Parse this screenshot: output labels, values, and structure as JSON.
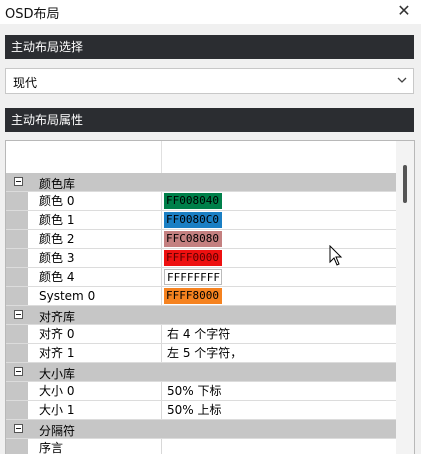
{
  "window": {
    "title": "OSD布局"
  },
  "section1": {
    "title": "主动布局选择"
  },
  "layout_select": {
    "value": "现代"
  },
  "section2": {
    "title": "主动布局属性"
  },
  "property_grid": {
    "color_lib": {
      "label": "颜色库",
      "items": [
        {
          "name": "颜色 0",
          "value": "FF008040",
          "swatch": "#00804a",
          "text_color": "#000000"
        },
        {
          "name": "颜色 1",
          "value": "FF0080C0",
          "swatch": "#1a7fc4",
          "text_color": "#000000"
        },
        {
          "name": "颜色 2",
          "value": "FFC08080",
          "swatch": "#c48080",
          "text_color": "#000000"
        },
        {
          "name": "颜色 3",
          "value": "FFFF0000",
          "swatch": "#ee1010",
          "text_color": "#5a0000"
        },
        {
          "name": "颜色 4",
          "value": "FFFFFFFF",
          "swatch": "#ffffff",
          "text_color": "#000000"
        },
        {
          "name": "System 0",
          "value": "FFFF8000",
          "swatch": "#f5821f",
          "text_color": "#000000"
        }
      ]
    },
    "align_lib": {
      "label": "对齐库",
      "items": [
        {
          "name": "对齐 0",
          "value": "右 4 个字符"
        },
        {
          "name": "对齐 1",
          "value": "左 5 个字符，"
        }
      ]
    },
    "size_lib": {
      "label": "大小库",
      "items": [
        {
          "name": "大小 0",
          "value": "50% 下标"
        },
        {
          "name": "大小 1",
          "value": "50% 上标"
        }
      ]
    },
    "separator": {
      "label": "分隔符",
      "items": [
        {
          "name": "序言",
          "value": ""
        }
      ]
    }
  }
}
